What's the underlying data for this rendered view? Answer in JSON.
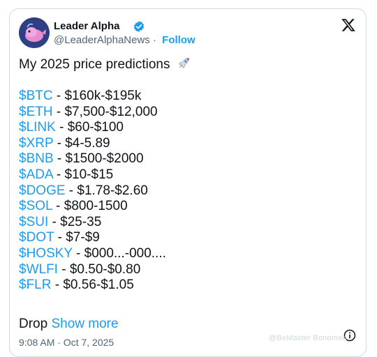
{
  "author": {
    "name": "Leader Alpha",
    "handle": "@LeaderAlphaNews",
    "separator": "·",
    "follow_label": "Follow"
  },
  "post": {
    "title": "My 2025 price predictions",
    "predictions": [
      {
        "ticker": "$BTC",
        "range": " - $160k-$195k"
      },
      {
        "ticker": "$ETH",
        "range": " - $7,500-$12,000"
      },
      {
        "ticker": "$LINK",
        "range": " - $60-$100"
      },
      {
        "ticker": "$XRP",
        "range": " - $4-5.89"
      },
      {
        "ticker": "$BNB",
        "range": " - $1500-$2000"
      },
      {
        "ticker": "$ADA",
        "range": " - $10-$15"
      },
      {
        "ticker": "$DOGE",
        "range": " - $1.78-$2.60"
      },
      {
        "ticker": "$SOL",
        "range": " - $800-1500"
      },
      {
        "ticker": "$SUI",
        "range": " - $25-35"
      },
      {
        "ticker": "$DOT",
        "range": " - $7-$9"
      },
      {
        "ticker": "$HOSKY",
        "range": " - $000...-000...."
      },
      {
        "ticker": "$WLFI",
        "range": " - $0.50-$0.80"
      },
      {
        "ticker": "$FLR",
        "range": " - $0.56-$1.05"
      }
    ],
    "truncated_text": "Drop",
    "show_more_label": "Show more",
    "timestamp": "9:08 AM · Oct 7, 2025"
  },
  "watermark": "@BeMaster Bonomen",
  "colors": {
    "accent": "#1d9bf0",
    "text": "#0f1419",
    "muted": "#536471"
  },
  "icons": [
    "verified-badge-icon",
    "x-logo-icon",
    "rocket-emoji-icon",
    "info-icon"
  ]
}
